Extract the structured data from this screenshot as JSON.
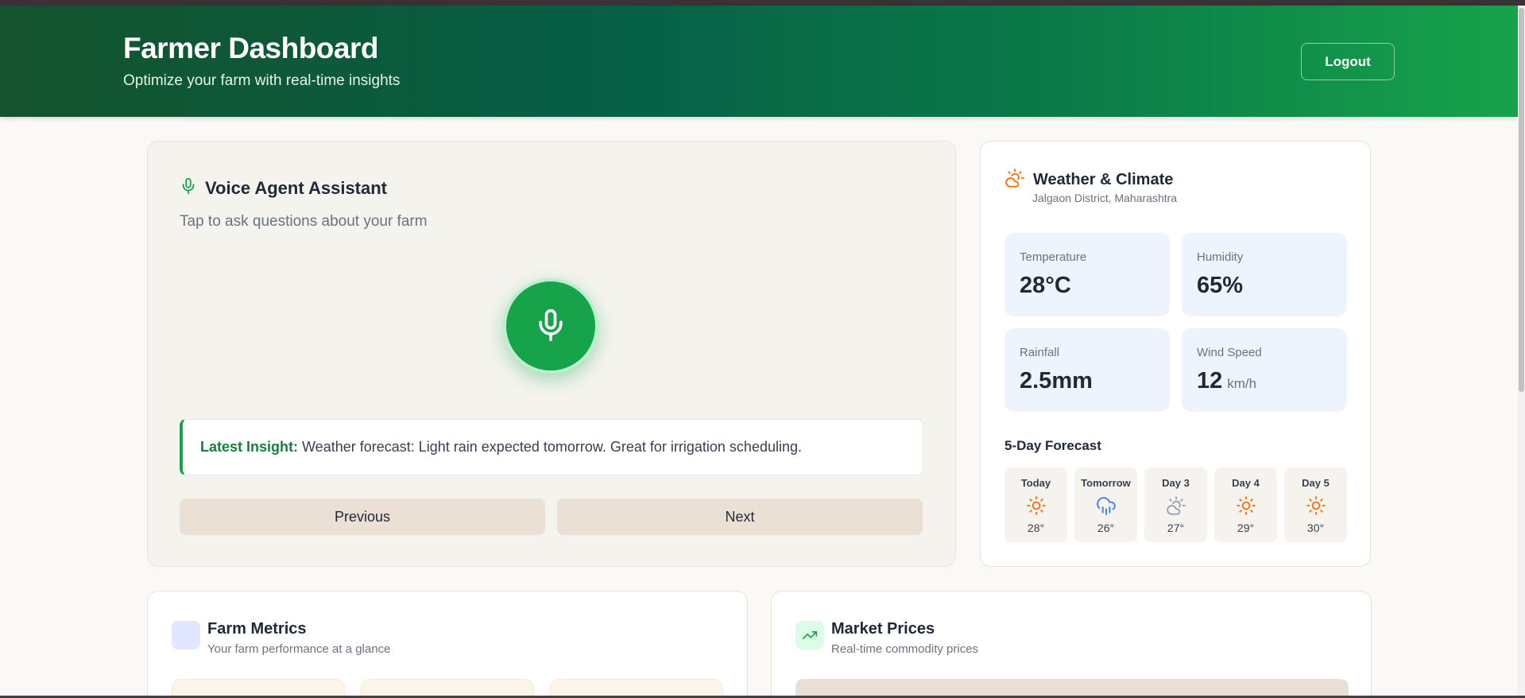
{
  "header": {
    "title": "Farmer Dashboard",
    "subtitle": "Optimize your farm with real-time insights",
    "logout_label": "Logout"
  },
  "voice": {
    "title": "Voice Agent Assistant",
    "subtitle": "Tap to ask questions about your farm",
    "insight_label": "Latest Insight:",
    "insight_text": " Weather forecast: Light rain expected tomorrow. Great for irrigation scheduling.",
    "previous_label": "Previous",
    "next_label": "Next"
  },
  "weather": {
    "title": "Weather & Climate",
    "location": "Jalgaon District, Maharashtra",
    "stats": [
      {
        "label": "Temperature",
        "value": "28°C",
        "unit": ""
      },
      {
        "label": "Humidity",
        "value": "65%",
        "unit": ""
      },
      {
        "label": "Rainfall",
        "value": "2.5mm",
        "unit": ""
      },
      {
        "label": "Wind Speed",
        "value": "12",
        "unit": "km/h"
      }
    ],
    "forecast_title": "5-Day Forecast",
    "forecast": [
      {
        "day": "Today",
        "icon": "sun-icon",
        "temp": "28°"
      },
      {
        "day": "Tomorrow",
        "icon": "rain-cloud-icon",
        "temp": "26°"
      },
      {
        "day": "Day 3",
        "icon": "partly-cloudy-icon",
        "temp": "27°"
      },
      {
        "day": "Day 4",
        "icon": "sun-icon",
        "temp": "29°"
      },
      {
        "day": "Day 5",
        "icon": "sun-icon",
        "temp": "30°"
      }
    ]
  },
  "metrics": {
    "title": "Farm Metrics",
    "subtitle": "Your farm performance at a glance"
  },
  "market": {
    "title": "Market Prices",
    "subtitle": "Real-time commodity prices"
  },
  "colors": {
    "accent": "#16a34a",
    "header_dark": "#14532d",
    "weather_icon": "#f97316",
    "rain_icon": "#3b82f6"
  }
}
